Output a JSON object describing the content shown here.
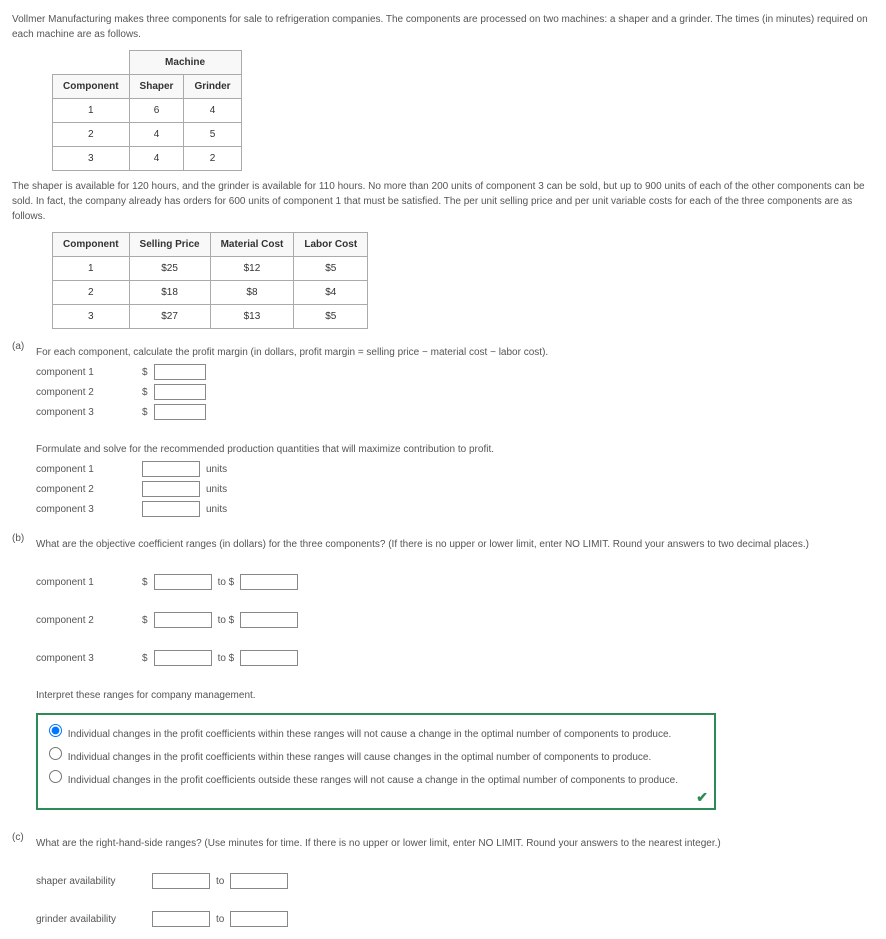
{
  "intro1": "Vollmer Manufacturing makes three components for sale to refrigeration companies. The components are processed on two machines: a shaper and a grinder. The times (in minutes) required on each machine are as follows.",
  "table1": {
    "h_machine": "Machine",
    "h_component": "Component",
    "h_shaper": "Shaper",
    "h_grinder": "Grinder",
    "rows": [
      {
        "c": "1",
        "s": "6",
        "g": "4"
      },
      {
        "c": "2",
        "s": "4",
        "g": "5"
      },
      {
        "c": "3",
        "s": "4",
        "g": "2"
      }
    ]
  },
  "intro2": "The shaper is available for 120 hours, and the grinder is available for 110 hours. No more than 200 units of component 3 can be sold, but up to 900 units of each of the other components can be sold. In fact, the company already has orders for 600 units of component 1 that must be satisfied. The per unit selling price and per unit variable costs for each of the three components are as follows.",
  "table2": {
    "h_component": "Component",
    "h_price": "Selling Price",
    "h_material": "Material Cost",
    "h_labor": "Labor Cost",
    "rows": [
      {
        "c": "1",
        "p": "$25",
        "m": "$12",
        "l": "$5"
      },
      {
        "c": "2",
        "p": "$18",
        "m": "$8",
        "l": "$4"
      },
      {
        "c": "3",
        "p": "$27",
        "m": "$13",
        "l": "$5"
      }
    ]
  },
  "a": {
    "label": "(a)",
    "q1": "For each component, calculate the profit margin (in dollars, profit margin = selling price − material cost − labor cost).",
    "comp1": "component 1",
    "comp2": "component 2",
    "comp3": "component 3",
    "dollar": "$",
    "q2": "Formulate and solve for the recommended production quantities that will maximize contribution to profit.",
    "units": "units"
  },
  "b": {
    "label": "(b)",
    "q": "What are the objective coefficient ranges (in dollars) for the three components? (If there is no upper or lower limit, enter NO LIMIT. Round your answers to two decimal places.)",
    "comp1": "component 1",
    "comp2": "component 2",
    "comp3": "component 3",
    "dollar": "$",
    "to_dollar": "to $",
    "interpret": "Interpret these ranges for company management.",
    "opt1": "Individual changes in the profit coefficients within these ranges will not cause a change in the optimal number of components to produce.",
    "opt2": "Individual changes in the profit coefficients within these ranges will cause changes in the optimal number of components to produce.",
    "opt3": "Individual changes in the profit coefficients outside these ranges will not cause a change in the optimal number of components to produce.",
    "check": "✔"
  },
  "c": {
    "label": "(c)",
    "q": "What are the right-hand-side ranges? (Use minutes for time. If there is no upper or lower limit, enter NO LIMIT. Round your answers to the nearest integer.)",
    "shaper": "shaper availability",
    "grinder": "grinder availability",
    "to": "to"
  }
}
